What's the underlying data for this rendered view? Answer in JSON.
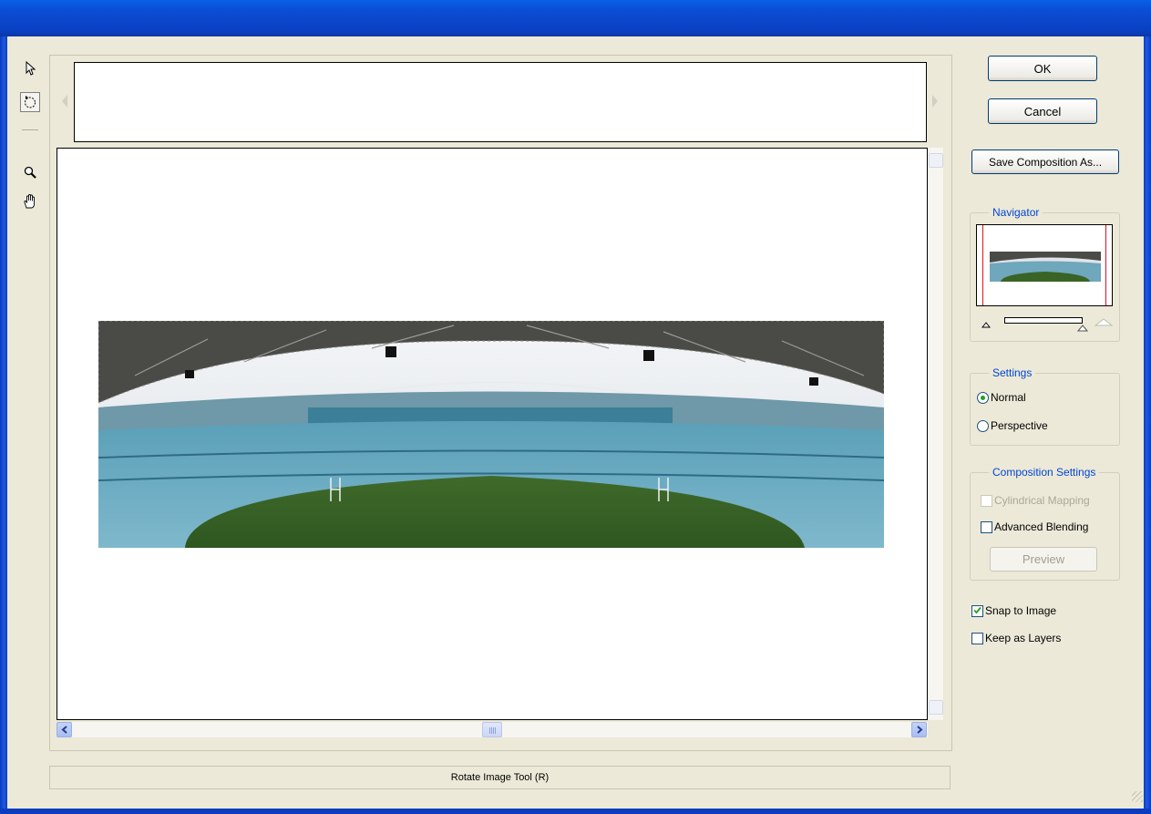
{
  "window": {
    "title": ""
  },
  "tools": [
    {
      "name": "select-image-tool",
      "icon": "arrow-pointer-icon"
    },
    {
      "name": "rotate-image-tool",
      "icon": "rotate-icon",
      "active": true
    },
    {
      "name": "zoom-tool",
      "icon": "magnifier-icon"
    },
    {
      "name": "hand-tool",
      "icon": "hand-icon"
    }
  ],
  "buttons": {
    "ok": "OK",
    "cancel": "Cancel",
    "save_composition": "Save Composition As...",
    "preview": "Preview"
  },
  "navigator": {
    "label": "Navigator"
  },
  "settings": {
    "label": "Settings",
    "options": [
      {
        "label": "Normal",
        "selected": true
      },
      {
        "label": "Perspective",
        "selected": false
      }
    ]
  },
  "composition_settings": {
    "label": "Composition Settings",
    "cylindrical_mapping": {
      "label": "Cylindrical Mapping",
      "checked": false,
      "disabled": true
    },
    "advanced_blending": {
      "label": "Advanced Blending",
      "checked": false
    }
  },
  "options": {
    "snap_to_image": {
      "label": "Snap to Image",
      "checked": true
    },
    "keep_as_layers": {
      "label": "Keep as Layers",
      "checked": false
    }
  },
  "status": {
    "text": "Rotate Image Tool (R)"
  },
  "colors": {
    "titlebar_blue": "#0a4fd6",
    "group_label_blue": "#0046d5",
    "navigator_frame_red": "#e0121a",
    "dialog_background": "#ece9d8"
  }
}
